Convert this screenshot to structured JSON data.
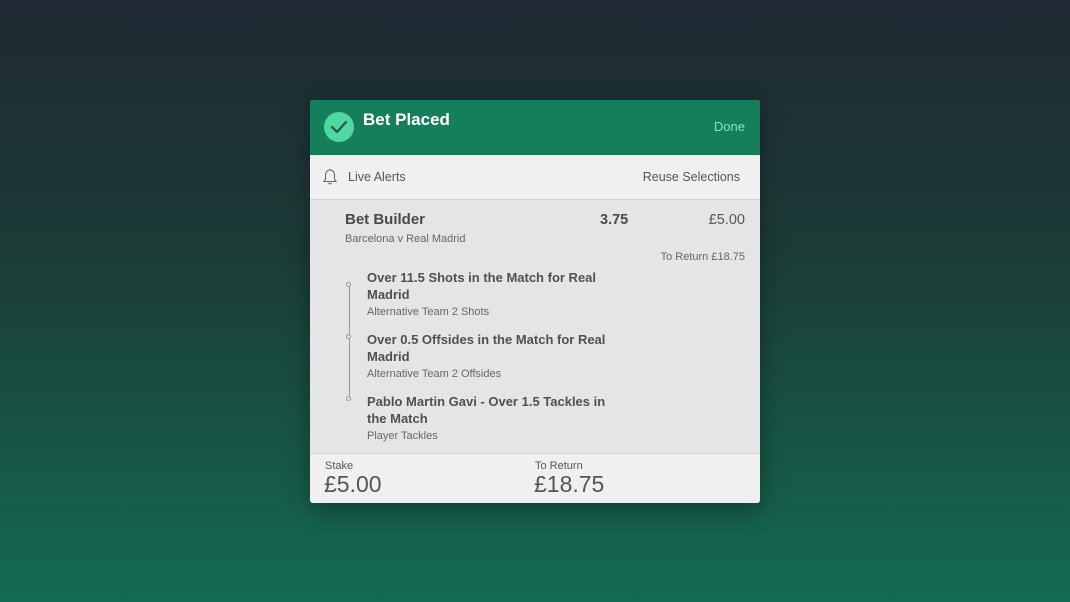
{
  "header": {
    "title": "Bet Placed",
    "done_label": "Done",
    "accent": "#157f5c",
    "check_color": "#4fd8a0"
  },
  "toolbar": {
    "live_alerts_label": "Live Alerts",
    "reuse_label": "Reuse Selections",
    "bell_icon": "bell-icon"
  },
  "bet": {
    "title": "Bet Builder",
    "match": "Barcelona v Real Madrid",
    "odds": "3.75",
    "stake": "£5.00",
    "to_return": "To Return £18.75",
    "selections": [
      {
        "title": "Over 11.5 Shots in the Match for Real Madrid",
        "sub": "Alternative Team 2 Shots"
      },
      {
        "title": "Over 0.5 Offsides in the Match for Real Madrid",
        "sub": "Alternative Team 2 Offsides"
      },
      {
        "title": "Pablo Martin Gavi - Over 1.5 Tackles in the Match",
        "sub": "Player Tackles"
      }
    ]
  },
  "footer": {
    "stake_label": "Stake",
    "stake_value": "£5.00",
    "return_label": "To Return",
    "return_value": "£18.75"
  }
}
